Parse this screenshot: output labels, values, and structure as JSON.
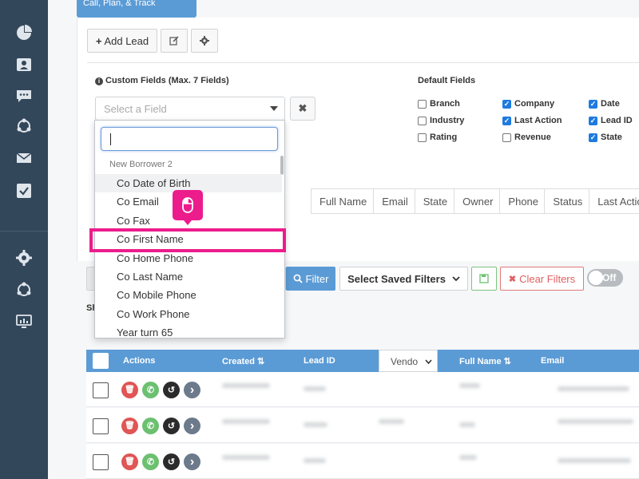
{
  "tab": {
    "label": "Call, Plan, & Track"
  },
  "toolbar": {
    "add_lead_label": "Add Lead"
  },
  "custom_fields": {
    "title": "Custom Fields (Max. 7 Fields)",
    "select_placeholder": "Select a Field",
    "clear_label": "✖"
  },
  "default_fields": {
    "title": "Default Fields",
    "items": [
      {
        "label": "Branch",
        "checked": false
      },
      {
        "label": "Company",
        "checked": true
      },
      {
        "label": "Date",
        "checked": true
      },
      {
        "label": "Industry",
        "checked": false
      },
      {
        "label": "Last Action",
        "checked": true
      },
      {
        "label": "Lead ID",
        "checked": true
      },
      {
        "label": "Rating",
        "checked": false
      },
      {
        "label": "Revenue",
        "checked": false
      },
      {
        "label": "State",
        "checked": true
      }
    ]
  },
  "column_preview": [
    "Full Name",
    "Email",
    "State",
    "Owner",
    "Phone",
    "Status",
    "Last Action"
  ],
  "dropdown": {
    "search_value": "",
    "group_label": "New Borrower 2",
    "options": [
      "Co Date of Birth",
      "Co Email",
      "Co Fax",
      "Co First Name",
      "Co Home Phone",
      "Co Last Name",
      "Co Mobile Phone",
      "Co Work Phone",
      "Year turn 65"
    ],
    "hovered_index": 0,
    "highlighted_index": 3
  },
  "filters": {
    "filter_label": "Filter",
    "saved_filters_label": "Select Saved Filters",
    "clear_filters_label": "Clear Filters",
    "toggle_label": "Off",
    "show_prefix": "Sh"
  },
  "table": {
    "headers": {
      "actions": "Actions",
      "created": "Created ⇅",
      "lead_id": "Lead ID",
      "vendor": "Vendo",
      "full_name": "Full Name ⇅",
      "email": "Email"
    }
  },
  "colors": {
    "sidebar": "#33475b",
    "accent": "#5b9bd5",
    "highlight": "#ec1c8c",
    "delete": "#e05555",
    "call": "#6cc070",
    "history": "#2b2b2b",
    "open": "#6c7a8c"
  },
  "icons": [
    "pie-chart-icon",
    "contact-card-icon",
    "chat-icon",
    "network-icon",
    "mail-icon",
    "task-check-icon",
    "gear-icon",
    "network-icon",
    "monitor-chart-icon"
  ]
}
